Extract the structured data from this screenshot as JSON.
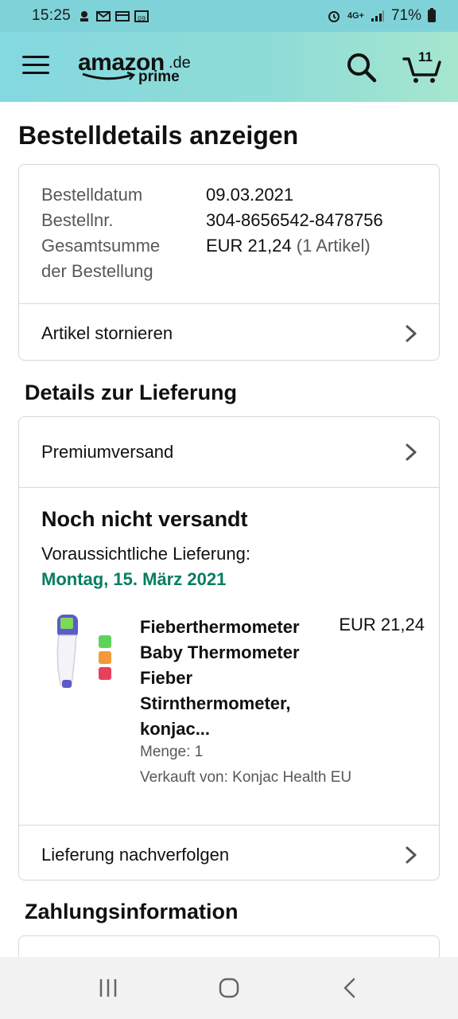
{
  "status_bar": {
    "time": "15:25",
    "battery": "71%",
    "network": "4G+"
  },
  "header": {
    "logo_text": "amazon",
    "logo_suffix": ".de",
    "logo_sub": "prime",
    "cart_count": "11",
    "accent_color": "#84d8e0"
  },
  "page": {
    "title": "Bestelldetails anzeigen"
  },
  "order_summary": {
    "order_date_label": "Bestelldatum",
    "order_date": "09.03.2021",
    "order_number_label": "Bestellnr.",
    "order_number": "304-8656542-8478756",
    "total_label_line1": "Gesamtsumme",
    "total_label_line2": "der Bestellung",
    "total_value": "EUR 21,24",
    "total_items": "(1 Artikel)",
    "cancel_label": "Artikel stornieren"
  },
  "delivery": {
    "heading": "Details zur Lieferung",
    "shipping_method": "Premiumversand",
    "status": "Noch nicht versandt",
    "estimate_label": "Voraussichtliche Lieferung:",
    "estimate_date": "Montag, 15. März 2021",
    "date_color": "#067d62",
    "item": {
      "title": "Fieberthermometer Baby Thermometer Fieber Stirnthermometer, konjac...",
      "price": "EUR 21,24",
      "quantity": "Menge: 1",
      "seller": "Verkauft von: Konjac Health EU"
    },
    "track_label": "Lieferung nachverfolgen"
  },
  "payment": {
    "heading": "Zahlungsinformation"
  },
  "nav": {
    "recents": "recents-icon",
    "home": "home-icon",
    "back": "back-icon"
  }
}
